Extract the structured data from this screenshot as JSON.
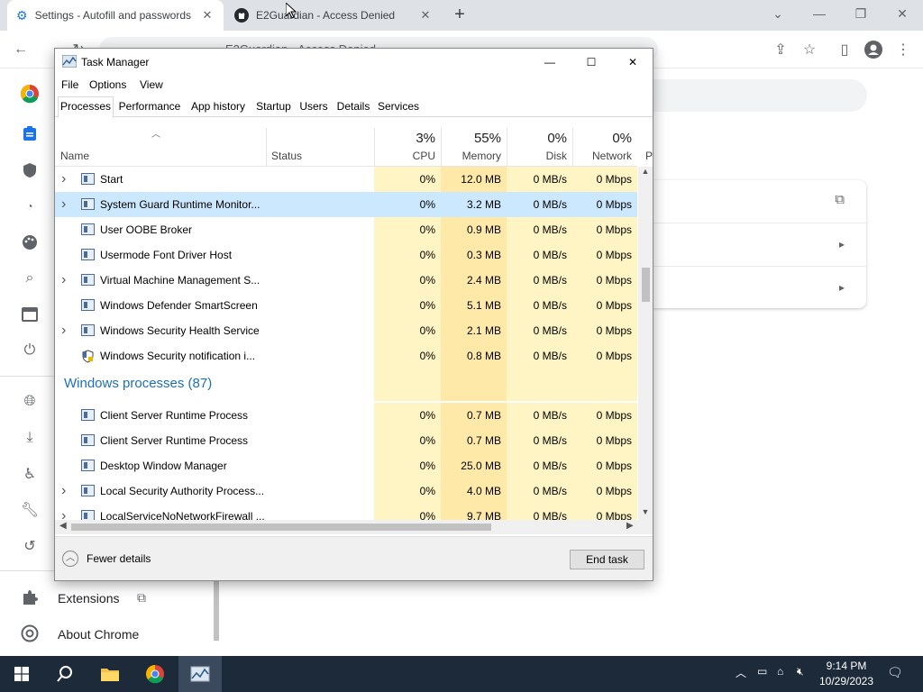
{
  "browser": {
    "tabs": [
      {
        "title": "Settings - Autofill and passwords",
        "active": true
      },
      {
        "title": "E2Guardian - Access Denied",
        "active": false
      }
    ],
    "new_tab": "+",
    "omnibox_text": "E2Guardian - Access Denied"
  },
  "settings": {
    "nav_bottom": [
      {
        "label": "Extensions"
      },
      {
        "label": "About Chrome"
      }
    ]
  },
  "task_manager": {
    "title": "Task Manager",
    "menu": [
      "File",
      "Options",
      "View"
    ],
    "tabs": [
      "Processes",
      "Performance",
      "App history",
      "Startup",
      "Users",
      "Details",
      "Services"
    ],
    "headers": {
      "name": "Name",
      "status": "Status",
      "cpu": {
        "pct": "3%",
        "label": "CPU"
      },
      "memory": {
        "pct": "55%",
        "label": "Memory"
      },
      "disk": {
        "pct": "0%",
        "label": "Disk"
      },
      "network": {
        "pct": "0%",
        "label": "Network"
      },
      "power": "P"
    },
    "processes": [
      {
        "name": "Start",
        "expandable": true,
        "cpu": "0%",
        "memory": "12.0 MB",
        "disk": "0 MB/s",
        "network": "0 Mbps"
      },
      {
        "name": "System Guard Runtime Monitor...",
        "expandable": true,
        "selected": true,
        "cpu": "0%",
        "memory": "3.2 MB",
        "disk": "0 MB/s",
        "network": "0 Mbps"
      },
      {
        "name": "User OOBE Broker",
        "expandable": false,
        "cpu": "0%",
        "memory": "0.9 MB",
        "disk": "0 MB/s",
        "network": "0 Mbps"
      },
      {
        "name": "Usermode Font Driver Host",
        "expandable": false,
        "cpu": "0%",
        "memory": "0.3 MB",
        "disk": "0 MB/s",
        "network": "0 Mbps"
      },
      {
        "name": "Virtual Machine Management S...",
        "expandable": true,
        "cpu": "0%",
        "memory": "2.4 MB",
        "disk": "0 MB/s",
        "network": "0 Mbps"
      },
      {
        "name": "Windows Defender SmartScreen",
        "expandable": false,
        "cpu": "0%",
        "memory": "5.1 MB",
        "disk": "0 MB/s",
        "network": "0 Mbps"
      },
      {
        "name": "Windows Security Health Service",
        "expandable": true,
        "cpu": "0%",
        "memory": "2.1 MB",
        "disk": "0 MB/s",
        "network": "0 Mbps"
      },
      {
        "name": "Windows Security notification i...",
        "expandable": false,
        "icon": "shield",
        "cpu": "0%",
        "memory": "0.8 MB",
        "disk": "0 MB/s",
        "network": "0 Mbps"
      }
    ],
    "group_label": "Windows processes (87)",
    "windows_processes": [
      {
        "name": "Client Server Runtime Process",
        "expandable": false,
        "cpu": "0%",
        "memory": "0.7 MB",
        "disk": "0 MB/s",
        "network": "0 Mbps"
      },
      {
        "name": "Client Server Runtime Process",
        "expandable": false,
        "cpu": "0%",
        "memory": "0.7 MB",
        "disk": "0 MB/s",
        "network": "0 Mbps"
      },
      {
        "name": "Desktop Window Manager",
        "expandable": false,
        "cpu": "0%",
        "memory": "25.0 MB",
        "disk": "0 MB/s",
        "network": "0 Mbps"
      },
      {
        "name": "Local Security Authority Process...",
        "expandable": true,
        "cpu": "0%",
        "memory": "4.0 MB",
        "disk": "0 MB/s",
        "network": "0 Mbps"
      },
      {
        "name": "LocalServiceNoNetworkFirewall ...",
        "expandable": true,
        "cpu": "0%",
        "memory": "9.7 MB",
        "disk": "0 MB/s",
        "network": "0 Mbps"
      }
    ],
    "fewer_details": "Fewer details",
    "end_task": "End task"
  },
  "taskbar": {
    "time": "9:14 PM",
    "date": "10/29/2023"
  },
  "colors": {
    "accent": "#1f6fb5",
    "selected_row": "#cce8ff",
    "heat_light": "#fff4c4",
    "heat_memory": "#ffe9a8",
    "taskbar": "#1c2a3a"
  }
}
